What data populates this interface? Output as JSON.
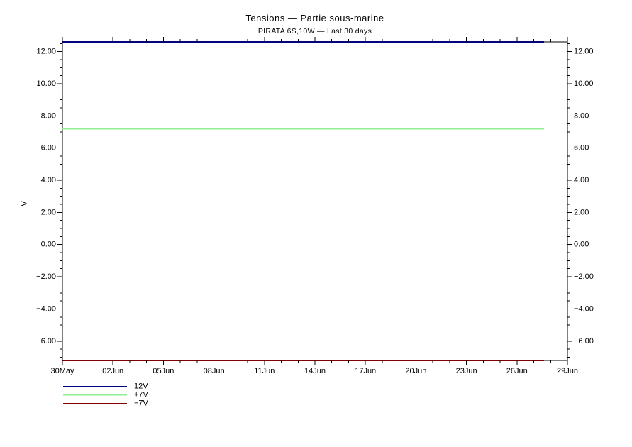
{
  "chart_data": {
    "type": "line",
    "title": "Tensions — Partie sous-marine",
    "subtitle": "PIRATA 6S,10W — Last 30 days",
    "xlabel": "",
    "ylabel": "V",
    "axis_color": "#000000",
    "grid": false,
    "x_range_days": [
      0,
      30
    ],
    "x_minor_step_days": 1,
    "x_major_days": [
      0,
      3,
      6,
      9,
      12,
      15,
      18,
      21,
      24,
      27,
      30
    ],
    "x_tick_labels": [
      "30May",
      "02Jun",
      "05Jun",
      "08Jun",
      "11Jun",
      "14Jun",
      "17Jun",
      "20Jun",
      "23Jun",
      "26Jun",
      "29Jun"
    ],
    "ylim": [
      -7.2,
      12.6
    ],
    "y_minor_step": 0.5,
    "y_major_ticks": [
      -6,
      -4,
      -2,
      0,
      2,
      4,
      6,
      8,
      10,
      12
    ],
    "y_tick_labels": [
      "−6.00",
      "−4.00",
      "−2.00",
      "0.00",
      "2.00",
      "4.00",
      "6.00",
      "8.00",
      "10.00",
      "12.00"
    ],
    "series": [
      {
        "name": "12V",
        "color": "#000080",
        "value": 12.6,
        "x_start_day": 0,
        "x_end_day": 28.6
      },
      {
        "name": "+7V",
        "color": "#90ee90",
        "value": 7.2,
        "x_start_day": 0,
        "x_end_day": 28.6
      },
      {
        "name": "−7V",
        "color": "#800000",
        "value": -7.2,
        "x_start_day": 0,
        "x_end_day": 28.6
      }
    ],
    "legend": {
      "position": "bottom-left",
      "entries": [
        {
          "label": "12V",
          "color": "#000080"
        },
        {
          "label": "+7V",
          "color": "#90ee90"
        },
        {
          "label": "−7V",
          "color": "#800000"
        }
      ]
    }
  }
}
